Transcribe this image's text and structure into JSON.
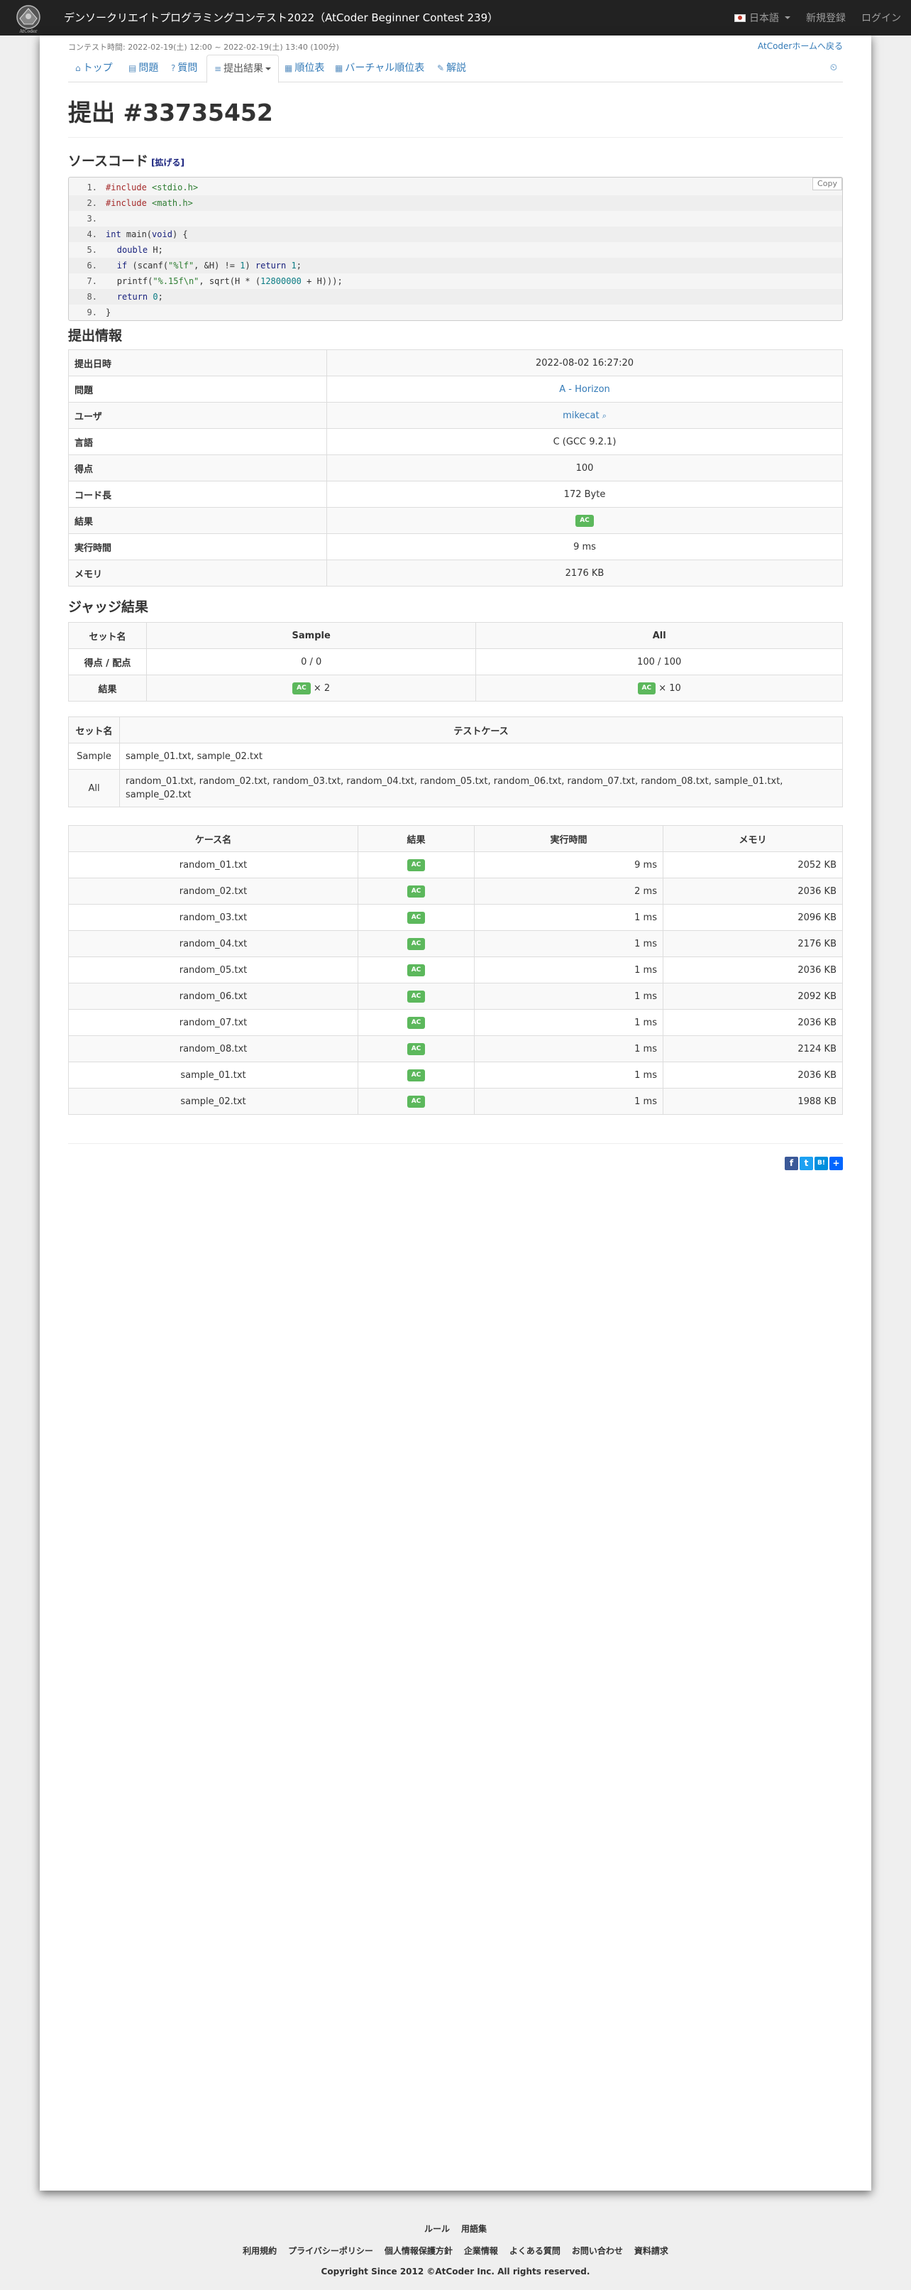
{
  "navbar": {
    "brand": "デンソークリエイトプログラミングコンテスト2022（AtCoder Beginner Contest 239）",
    "language": "日本語",
    "register": "新規登録",
    "login": "ログイン"
  },
  "contest_time": "コンテスト時間: 2022-02-19(土) 12:00 ~ 2022-02-19(土) 13:40 (100分)",
  "home_link": "AtCoderホームへ戻る",
  "tabs": [
    {
      "label": "トップ"
    },
    {
      "label": "問題"
    },
    {
      "label": "質問"
    },
    {
      "label": "提出結果"
    },
    {
      "label": "順位表"
    },
    {
      "label": "バーチャル順位表"
    },
    {
      "label": "解説"
    }
  ],
  "page_title": "提出 #33735452",
  "source": {
    "heading": "ソースコード",
    "expand": "[拡げる]",
    "copy": "Copy",
    "line_numbers": [
      "1.",
      "2.",
      "3.",
      "4.",
      "5.",
      "6.",
      "7.",
      "8.",
      "9."
    ]
  },
  "info": {
    "heading": "提出情報",
    "rows": [
      {
        "label": "提出日時",
        "value": "2022-08-02 16:27:20"
      },
      {
        "label": "問題",
        "value": "A - Horizon"
      },
      {
        "label": "ユーザ",
        "value": "mikecat"
      },
      {
        "label": "言語",
        "value": "C (GCC 9.2.1)"
      },
      {
        "label": "得点",
        "value": "100"
      },
      {
        "label": "コード長",
        "value": "172 Byte"
      },
      {
        "label": "結果",
        "value": "AC"
      },
      {
        "label": "実行時間",
        "value": "9 ms"
      },
      {
        "label": "メモリ",
        "value": "2176 KB"
      }
    ]
  },
  "judge": {
    "heading": "ジャッジ結果",
    "set_header": "セット名",
    "col_sample": "Sample",
    "col_all": "All",
    "score_label": "得点 / 配点",
    "score_sample": "0 / 0",
    "score_all": "100 / 100",
    "result_label": "結果",
    "ac": "AC",
    "sample_count": "× 2",
    "all_count": "× 10"
  },
  "testsets": {
    "set_header": "セット名",
    "cases_header": "テストケース",
    "rows": [
      {
        "name": "Sample",
        "cases": "sample_01.txt, sample_02.txt"
      },
      {
        "name": "All",
        "cases": "random_01.txt, random_02.txt, random_03.txt, random_04.txt, random_05.txt, random_06.txt, random_07.txt, random_08.txt, sample_01.txt, sample_02.txt"
      }
    ]
  },
  "cases": {
    "headers": [
      "ケース名",
      "結果",
      "実行時間",
      "メモリ"
    ],
    "rows": [
      {
        "name": "random_01.txt",
        "result": "AC",
        "time": "9 ms",
        "memory": "2052 KB"
      },
      {
        "name": "random_02.txt",
        "result": "AC",
        "time": "2 ms",
        "memory": "2036 KB"
      },
      {
        "name": "random_03.txt",
        "result": "AC",
        "time": "1 ms",
        "memory": "2096 KB"
      },
      {
        "name": "random_04.txt",
        "result": "AC",
        "time": "1 ms",
        "memory": "2176 KB"
      },
      {
        "name": "random_05.txt",
        "result": "AC",
        "time": "1 ms",
        "memory": "2036 KB"
      },
      {
        "name": "random_06.txt",
        "result": "AC",
        "time": "1 ms",
        "memory": "2092 KB"
      },
      {
        "name": "random_07.txt",
        "result": "AC",
        "time": "1 ms",
        "memory": "2036 KB"
      },
      {
        "name": "random_08.txt",
        "result": "AC",
        "time": "1 ms",
        "memory": "2124 KB"
      },
      {
        "name": "sample_01.txt",
        "result": "AC",
        "time": "1 ms",
        "memory": "2036 KB"
      },
      {
        "name": "sample_02.txt",
        "result": "AC",
        "time": "1 ms",
        "memory": "1988 KB"
      }
    ]
  },
  "colors": {
    "accent": "#337ab7",
    "ac": "#5cb85c",
    "navbar": "#222222"
  },
  "footer": {
    "row1": [
      "ルール",
      "用語集"
    ],
    "row2": [
      "利用規約",
      "プライバシーポリシー",
      "個人情報保護方針",
      "企業情報",
      "よくある質問",
      "お問い合わせ",
      "資料請求"
    ],
    "copyright": "Copyright Since 2012 ©AtCoder Inc. All rights reserved."
  }
}
